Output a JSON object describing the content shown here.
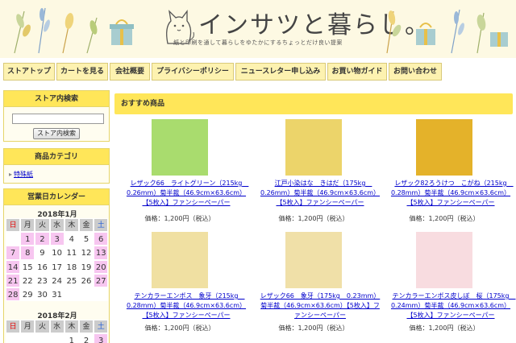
{
  "header": {
    "title": "インサツと暮らし。",
    "tagline": "紙と印刷を通して暮らしをゆたかにするちょっとだけ良い提案"
  },
  "nav": [
    {
      "label": "ストアトップ"
    },
    {
      "label": "カートを見る"
    },
    {
      "label": "会社概要"
    },
    {
      "label": "プライバシーポリシー"
    },
    {
      "label": "ニュースレター申し込み"
    },
    {
      "label": "お買い物ガイド"
    },
    {
      "label": "お問い合わせ"
    }
  ],
  "search": {
    "title": "ストア内検索",
    "value": "",
    "button_label": "ストア内検索"
  },
  "categories": {
    "title": "商品カテゴリ",
    "items": [
      {
        "label": "特殊紙"
      }
    ]
  },
  "calendar": {
    "title": "営業日カレンダー",
    "weekdays": [
      "日",
      "月",
      "火",
      "水",
      "木",
      "金",
      "土"
    ],
    "months": [
      {
        "label": "2018年1月",
        "days": [
          "",
          "1",
          "2",
          "3",
          "4",
          "5",
          "6",
          "7",
          "8",
          "9",
          "10",
          "11",
          "12",
          "13",
          "14",
          "15",
          "16",
          "17",
          "18",
          "19",
          "20",
          "21",
          "22",
          "23",
          "24",
          "25",
          "26",
          "27",
          "28",
          "29",
          "30",
          "31",
          "",
          "",
          ""
        ],
        "closed": [
          "1",
          "2",
          "3",
          "6",
          "7",
          "8",
          "13",
          "14",
          "20",
          "21",
          "27",
          "28"
        ]
      },
      {
        "label": "2018年2月",
        "days": [
          "",
          "",
          "",
          "",
          "1",
          "2",
          "3"
        ],
        "closed": [
          "3"
        ]
      }
    ]
  },
  "main": {
    "section_title": "おすすめ商品",
    "products": [
      {
        "name": "レザック66　ライトグリーン（215kg　0.26mm）菊半裁（46.9cm×63.6cm）【5枚入】ファンシーペーパー",
        "price": "価格：1,200円（税込）",
        "color": "#a9dc6e"
      },
      {
        "name": "江戸小染はな　きはだ（175kg　0.26mm）菊半裁（46.9cm×63.6cm）【5枚入】ファンシーペーパー",
        "price": "価格：1,200円（税込）",
        "color": "#ecd46a"
      },
      {
        "name": "レザック82ろうけつ　こがね（215kg　0.28mm）菊半裁（46.9cm×63.6cm）【5枚入】ファンシーペーパー",
        "price": "価格：1,200円（税込）",
        "color": "#e4b22a"
      },
      {
        "name": "テンカラーエンボス　象牙（215kg　0.28mm）菊半裁（46.9cm×63.6cm）【5枚入】ファンシーペーパー",
        "price": "価格：1,200円（税込）",
        "color": "#f0e0a2"
      },
      {
        "name": "レザック66　象牙（175kg　0.23mm）菊半裁（46.9cm×63.6cm）【5枚入】ファンシーペーパー",
        "price": "価格：1,200円（税込）",
        "color": "#f0e0a8"
      },
      {
        "name": "テンカラーエンボス皮しぼ　桜（175kg　0.24mm）菊半裁（46.9cm×63.6cm）【5枚入】ファンシーペーパー",
        "price": "価格：1,200円（税込）",
        "color": "#f8dce0"
      }
    ]
  }
}
